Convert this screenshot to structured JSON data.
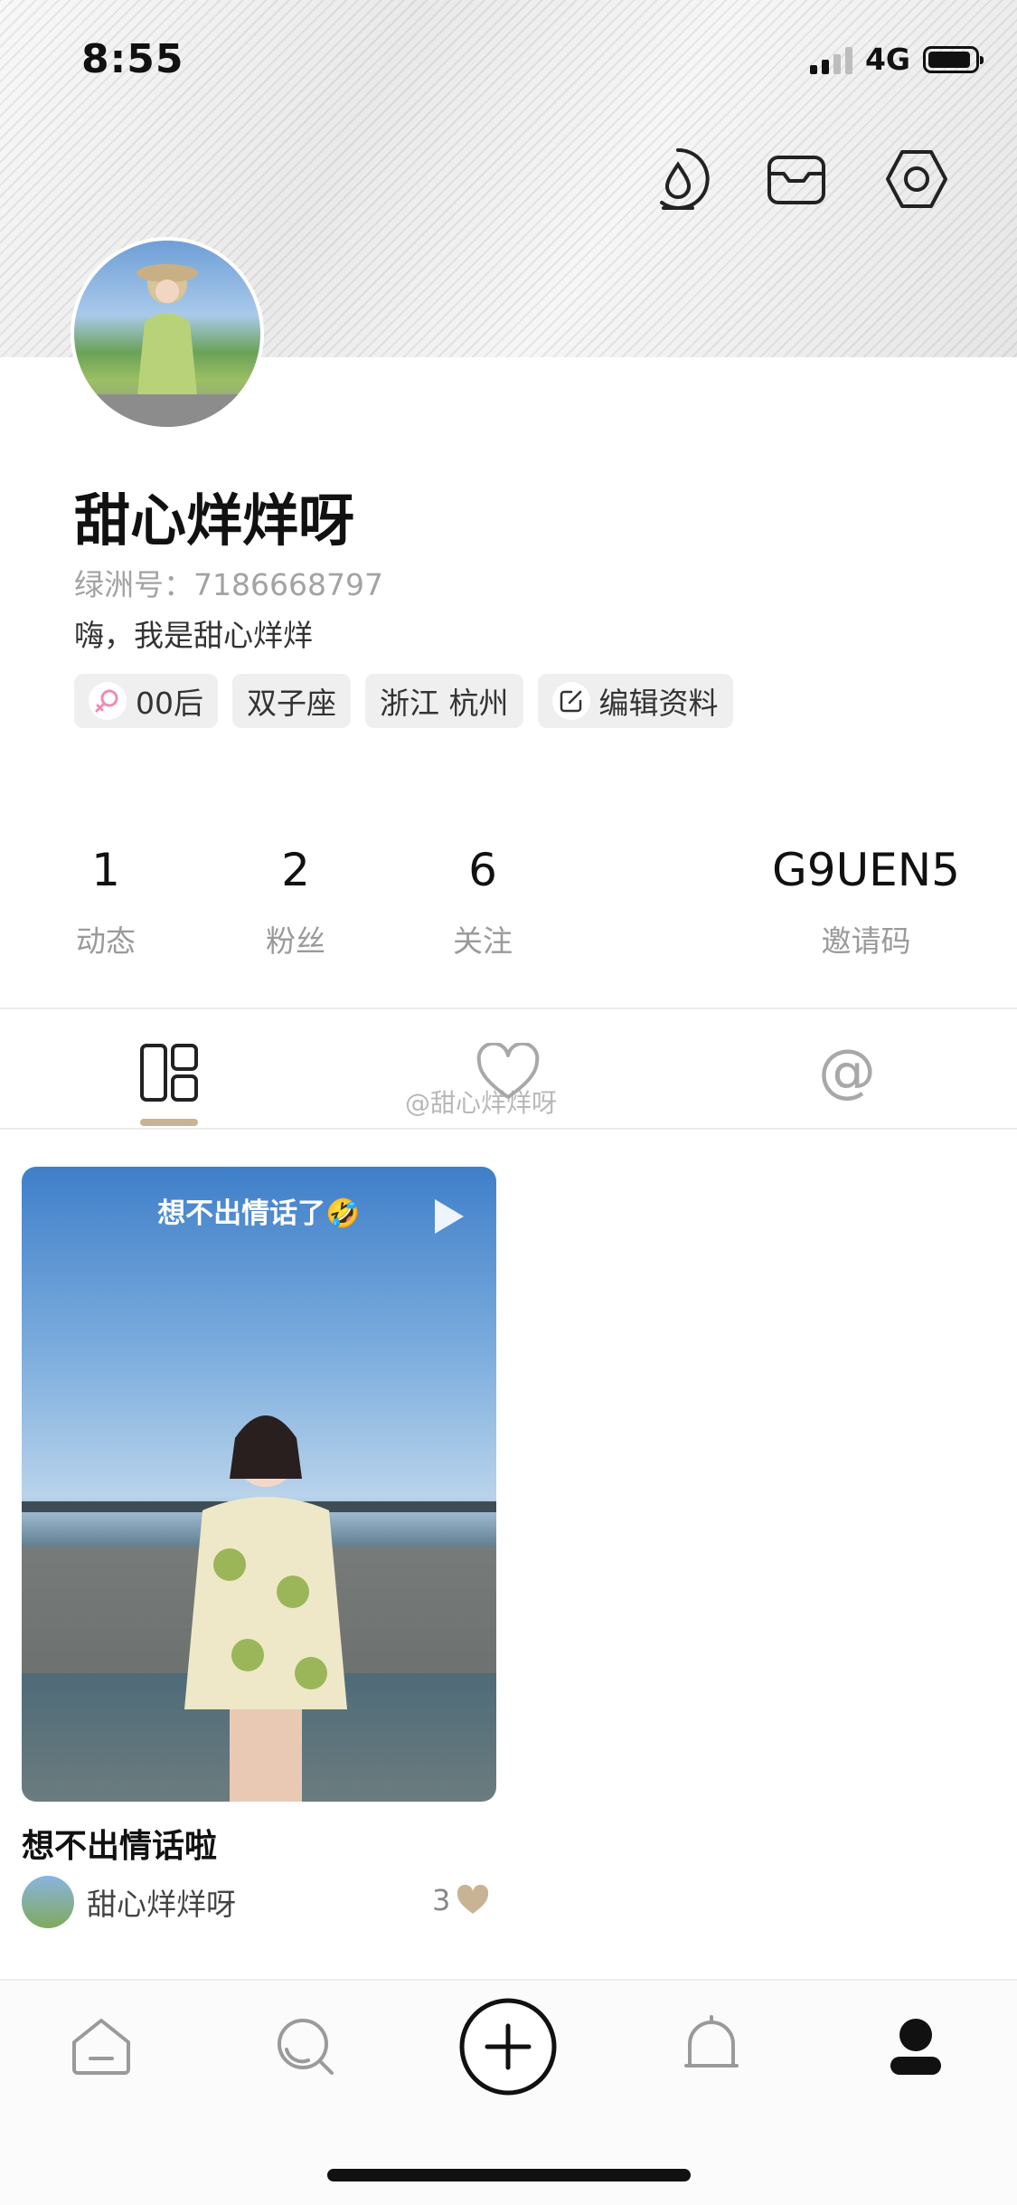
{
  "status_bar": {
    "time": "8:55",
    "network": "4G"
  },
  "header_icons": [
    "drop-icon",
    "inbox-icon",
    "settings-icon"
  ],
  "profile": {
    "name": "甜心烊烊呀",
    "oasis_id": "绿洲号：7186668797",
    "bio": "嗨，我是甜心烊烊",
    "tags": [
      "00后",
      "双子座",
      "浙江 杭州"
    ],
    "edit_label": "编辑资料"
  },
  "stats": [
    {
      "value": "1",
      "label": "动态"
    },
    {
      "value": "2",
      "label": "粉丝"
    },
    {
      "value": "6",
      "label": "关注"
    }
  ],
  "invite": {
    "value": "G9UEN5",
    "label": "邀请码"
  },
  "tabs": [
    "grid-icon",
    "heart-outline-icon",
    "at-icon"
  ],
  "watermark": "@甜心烊烊呀",
  "post": {
    "caption": "想不出情话了🤣",
    "title": "想不出情话啦",
    "author": "甜心烊烊呀",
    "likes": "3"
  },
  "colors": {
    "accent": "#c8b495",
    "tag_bg": "#efefef",
    "female_pink": "#f08cb4"
  }
}
